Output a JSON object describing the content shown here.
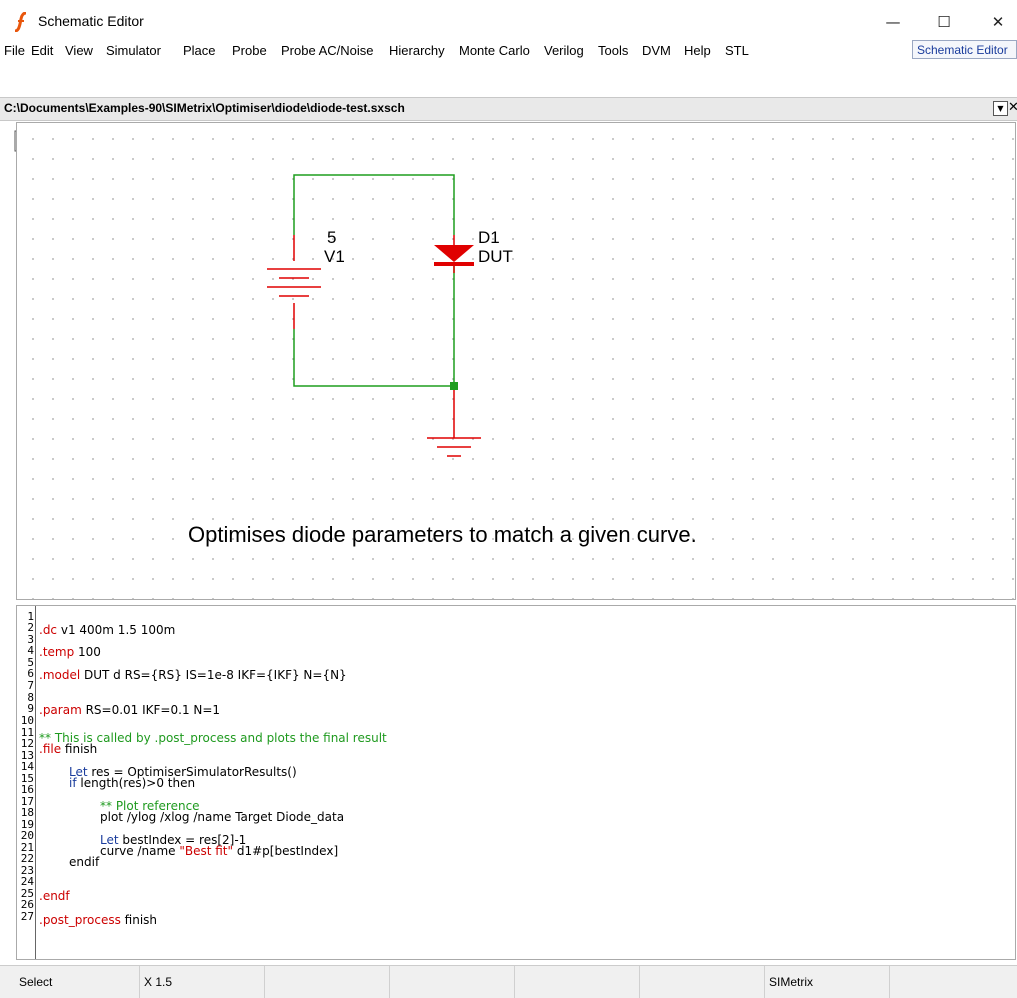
{
  "window": {
    "title": "Schematic Editor",
    "minimize": "—",
    "maximize": "☐",
    "close": "✕"
  },
  "menu": {
    "items": [
      "File",
      "Edit",
      "View",
      "Simulator",
      "Place",
      "Probe",
      "Probe AC/Noise",
      "Hierarchy",
      "Monte Carlo",
      "Verilog",
      "Tools",
      "DVM",
      "Help",
      "STL"
    ],
    "mode": "Schematic Editor"
  },
  "toolbar": {
    "icons": [
      "new-icon",
      "dropdown-icon",
      "open-icon",
      "close-icon",
      "save-icon",
      "save-all-icon",
      "print-icon",
      "settings-icon",
      "undo-icon",
      "redo-icon",
      "add-symbol-icon",
      "place-icon",
      "cut-icon",
      "rotate-icon",
      "mirror-icon",
      "flip-icon",
      "zoom-box-icon",
      "zoom-out-icon",
      "zoom-in-icon",
      "zoom-fit-icon",
      "wire-pen-icon",
      "run-icon",
      "pause-icon",
      "find-icon",
      "resistor-icon",
      "capacitor-icon",
      "inductor-icon",
      "ground-icon",
      "voltage-source-icon",
      "current-source-icon",
      "diode-icon",
      "zener-icon",
      "npn-icon",
      "pnp-icon"
    ]
  },
  "path": {
    "file": "C:\\Documents\\Examples-90\\SIMetrix\\Optimiser\\diode\\diode-test.sxsch"
  },
  "schematic": {
    "source_value": "5",
    "source_ref": "V1",
    "diode_ref": "D1",
    "diode_model": "DUT",
    "caption": "Optimises diode parameters to match a given curve.",
    "colors": {
      "wire": "#1e9e1e",
      "component": "#e00000",
      "junction": "#1e9e1e"
    }
  },
  "netlist": {
    "line_numbers": [
      "1",
      "2",
      "3",
      "4",
      "5",
      "6",
      "7",
      "8",
      "9",
      "10",
      "11",
      "12",
      "13",
      "14",
      "15",
      "16",
      "17",
      "18",
      "19",
      "20",
      "21",
      "22",
      "23",
      "24",
      "25",
      "26",
      "27"
    ],
    "lines": {
      "l2_kw": ".dc",
      "l2_rest": " v1 400m 1.5 100m",
      "l4_kw": ".temp",
      "l4_rest": " 100",
      "l6_kw": ".model",
      "l6_rest": " DUT d RS={RS} IS=1e-8 IKF={IKF} N={N}",
      "l9_kw": ".param",
      "l9_rest": " RS=0.01 IKF=0.1 N=1",
      "l11": "** This is called by .post_process and plots the final result",
      "l12_kw": ".file",
      "l12_rest": " finish",
      "l14_kw": "Let",
      "l14_rest": " res = OptimiserSimulatorResults()",
      "l15_kw": "if",
      "l15_rest": " length(res)>0 then",
      "l17": "** Plot reference",
      "l18": "plot /ylog /xlog /name Target Diode_data",
      "l20_kw": "Let",
      "l20_rest": " bestIndex = res[2]-1",
      "l21_a": "curve /name ",
      "l21_str": "\"Best fit\"",
      "l21_b": " d1#p[bestIndex]",
      "l22": "endif",
      "l24_kw": ".endf",
      "l26_kw": ".post_process",
      "l26_rest": " finish"
    }
  },
  "status": {
    "mode": "Select",
    "coord": "X 1.5",
    "product": "SIMetrix"
  }
}
